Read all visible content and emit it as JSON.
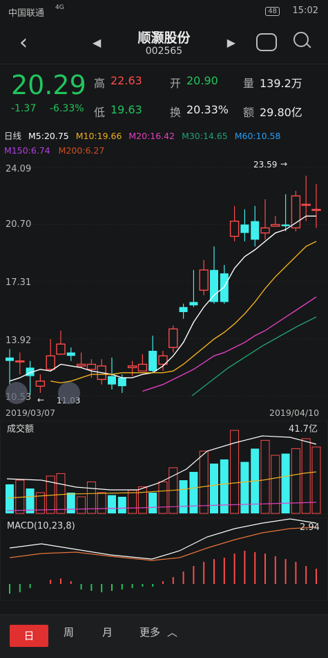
{
  "status": {
    "carrier": "中国联通",
    "network": "4G",
    "battery": "48",
    "time": "15:02"
  },
  "nav": {
    "name": "顺灏股份",
    "code": "002565"
  },
  "quote": {
    "price": "20.29",
    "change": "-1.37",
    "change_pct": "-6.33%",
    "high_label": "高",
    "high": "22.63",
    "low_label": "低",
    "low": "19.63",
    "open_label": "开",
    "open": "20.90",
    "turnover_label": "换",
    "turnover": "20.33%",
    "volume_label": "量",
    "volume": "139.2万",
    "amount_label": "额",
    "amount": "29.80亿"
  },
  "ma": {
    "period": "日线",
    "m5": "M5:20.75",
    "m10": "M10:19.66",
    "m20": "M20:16.42",
    "m30": "M30:14.65",
    "m60": "M60:10.58",
    "m150": "M150:6.74",
    "m200": "M200:6.27"
  },
  "colors": {
    "up": "#ff4b4b",
    "down": "#3ef0ee",
    "m5": "#ffffff",
    "m10": "#f0b020",
    "m20": "#e040c0",
    "m30": "#20a070",
    "m60": "#2a9df4",
    "m150": "#b040e0",
    "m200": "#d05020"
  },
  "chart_data": {
    "type": "candlestick",
    "ytick_labels": [
      "24.09",
      "20.70",
      "17.31",
      "13.92",
      "10.53"
    ],
    "x_start": "2019/03/07",
    "x_end": "2019/04/10",
    "annotations": [
      "23.59",
      "11.03"
    ],
    "candles": [
      [
        12.8,
        12.6,
        13.3,
        11.2
      ],
      [
        12.6,
        12.6,
        13.1,
        11.8
      ],
      [
        12.2,
        11.7,
        12.6,
        10.6
      ],
      [
        11.1,
        11.4,
        11.8,
        10.7
      ],
      [
        12.1,
        12.9,
        13.9,
        12.0
      ],
      [
        13.0,
        13.6,
        14.4,
        13.3
      ],
      [
        13.1,
        12.9,
        13.4,
        12.6
      ],
      [
        12.3,
        12.4,
        13.1,
        12.2
      ],
      [
        12.1,
        12.4,
        12.7,
        11.6
      ],
      [
        11.5,
        12.3,
        12.7,
        11.2
      ],
      [
        11.7,
        11.2,
        12.8,
        10.9
      ],
      [
        11.6,
        11.1,
        11.8,
        10.7
      ],
      [
        12.2,
        12.3,
        12.6,
        11.7
      ],
      [
        12.0,
        12.4,
        13.0,
        12.4
      ],
      [
        13.2,
        12.0,
        14.1,
        11.9
      ],
      [
        12.4,
        12.9,
        13.2,
        12.0
      ],
      [
        13.4,
        14.5,
        14.7,
        13.1
      ],
      [
        15.8,
        15.5,
        16.0,
        15.1
      ],
      [
        16.1,
        15.9,
        18.0,
        15.8
      ],
      [
        16.8,
        18.0,
        18.6,
        16.5
      ],
      [
        18.0,
        16.1,
        19.4,
        16.0
      ],
      [
        17.8,
        16.1,
        18.3,
        16.0
      ],
      [
        20.0,
        20.9,
        21.8,
        19.7
      ],
      [
        20.7,
        20.2,
        21.6,
        19.7
      ],
      [
        20.9,
        19.8,
        21.8,
        19.4
      ],
      [
        20.2,
        20.5,
        22.2,
        19.8
      ],
      [
        20.6,
        20.7,
        21.2,
        20.7
      ],
      [
        20.7,
        20.6,
        22.5,
        20.3
      ],
      [
        20.5,
        22.4,
        22.7,
        20.3
      ],
      [
        21.9,
        21.9,
        23.6,
        20.9
      ],
      [
        21.6,
        21.6,
        23.1,
        20.5
      ]
    ],
    "ma_lines": {
      "m5": [
        11.4,
        11.6,
        11.9,
        12.1,
        12.0,
        12.4,
        12.3,
        12.2,
        12.0,
        11.9,
        11.8,
        11.6,
        11.6,
        11.8,
        11.9,
        12.3,
        12.9,
        13.7,
        14.9,
        15.8,
        16.5,
        17.0,
        18.1,
        18.8,
        19.2,
        19.7,
        20.2,
        20.4,
        20.8,
        21.2,
        21.2
      ],
      "m10": [
        null,
        null,
        null,
        null,
        11.4,
        11.3,
        11.4,
        11.6,
        11.8,
        11.8,
        11.8,
        11.9,
        11.9,
        11.9,
        11.9,
        11.9,
        12.0,
        12.4,
        12.9,
        13.4,
        13.9,
        14.3,
        14.8,
        15.4,
        16.1,
        16.9,
        17.6,
        18.2,
        18.8,
        19.4,
        19.7
      ],
      "m20": [
        null,
        null,
        null,
        null,
        null,
        null,
        null,
        null,
        null,
        null,
        null,
        null,
        null,
        10.8,
        11.0,
        11.2,
        11.5,
        11.8,
        12.1,
        12.5,
        12.9,
        13.1,
        13.4,
        13.7,
        14.1,
        14.4,
        14.8,
        15.2,
        15.6,
        16.0,
        16.4
      ],
      "m30": [
        null,
        null,
        null,
        null,
        null,
        null,
        null,
        null,
        null,
        null,
        null,
        null,
        null,
        null,
        null,
        null,
        null,
        null,
        null,
        null,
        null,
        null,
        null,
        null,
        null,
        null,
        null,
        null,
        null,
        null,
        null
      ]
    }
  },
  "volume_panel": {
    "label": "成交额",
    "value": "41.7亿"
  },
  "macd_panel": {
    "label": "MACD(10,23,8)",
    "value": "2.94"
  },
  "tabs": {
    "day": "日",
    "week": "周",
    "month": "月",
    "more": "更多",
    "more_icon": "chevron-up-icon"
  }
}
